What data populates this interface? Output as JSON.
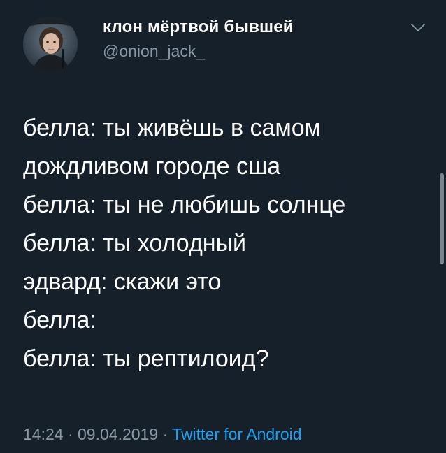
{
  "author": {
    "display_name": "клон мёртвой бывшей",
    "handle": "@onion_jack_"
  },
  "icons": {
    "avatar": "profile-photo",
    "menu": "chevron-down-icon"
  },
  "tweet": {
    "lines": [
      "белла: ты живёшь в самом",
      "дождливом городе сша",
      "белла: ты не любишь солнце",
      "белла: ты холодный",
      "эдвард: скажи это",
      "белла:",
      "белла: ты рептилоид?"
    ]
  },
  "meta": {
    "time": "14:24",
    "separator": "·",
    "date": "09.04.2019",
    "source": "Twitter for Android"
  },
  "colors": {
    "background": "#15202b",
    "text": "#ffffff",
    "secondary": "#8899a6",
    "link": "#1da1f2"
  }
}
